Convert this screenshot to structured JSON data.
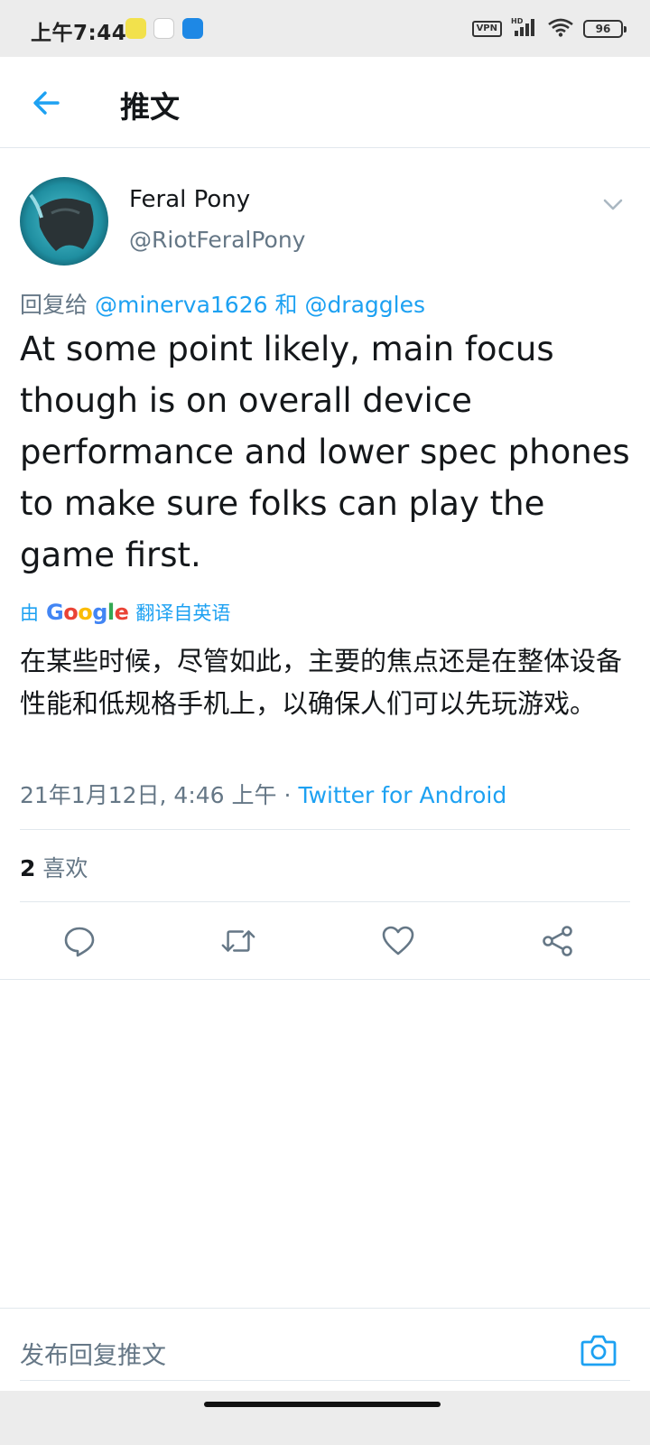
{
  "status_bar": {
    "time": "上午7:44",
    "vpn": "VPN",
    "network": "HD",
    "battery": "96"
  },
  "app_bar": {
    "title": "推文"
  },
  "tweet": {
    "author_name": "Feral Pony",
    "author_handle": "@RiotFeralPony",
    "reply_prefix": "回复给",
    "reply_mention_1": "@minerva1626",
    "reply_conjunction": "和",
    "reply_mention_2": "@draggles",
    "text": "At some point likely, main focus though is on overall device performance and lower spec phones to make sure folks can play the game first.",
    "translated_prefix": "由",
    "translated_brand": "Google",
    "translated_suffix": "翻译自英语",
    "translation": "在某些时候，尽管如此，主要的焦点还是在整体设备性能和低规格手机上，以确保人们可以先玩游戏。",
    "timestamp": "21年1月12日, 4:46 上午",
    "separator": "·",
    "source": "Twitter for Android",
    "likes_count": "2",
    "likes_label": "喜欢"
  },
  "reply_bar": {
    "placeholder": "发布回复推文"
  },
  "icons": {
    "back": "arrow-left-icon",
    "more": "chevron-down-icon",
    "reply": "comment-icon",
    "retweet": "retweet-icon",
    "like": "heart-icon",
    "share": "share-icon",
    "camera": "camera-icon"
  },
  "colors": {
    "accent": "#1da1f2",
    "text_primary": "#14171a",
    "text_secondary": "#657786",
    "divider": "#e1e8ed"
  }
}
